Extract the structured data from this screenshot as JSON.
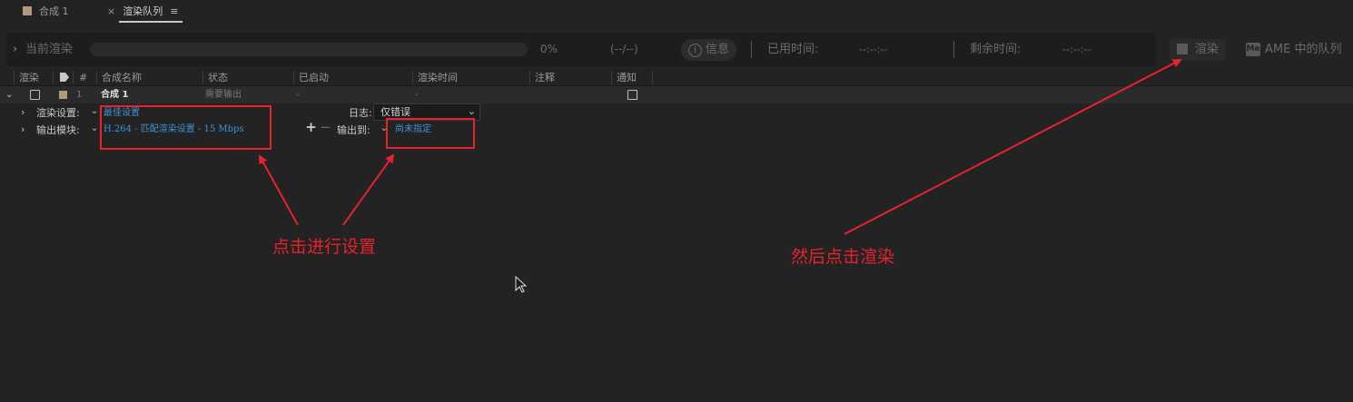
{
  "tabs": {
    "comp_tab_label": "合成 1",
    "render_queue_tab_label": "渲染队列",
    "close_glyph": "×",
    "menu_glyph": "≡"
  },
  "status_bar": {
    "current_render_label": "当前渲染",
    "percent": "0%",
    "ratio": "(--/--)",
    "info_label": "信息",
    "elapsed_label": "已用时间:",
    "elapsed_value": "--:--:--",
    "remaining_label": "剩余时间:",
    "remaining_value": "--:--:--",
    "progress_fraction": 0
  },
  "buttons": {
    "render_label": "渲染",
    "ame_label": "AME 中的队列",
    "ame_icon_text": "Me"
  },
  "columns": {
    "render": "渲染",
    "number": "#",
    "comp_name": "合成名称",
    "status": "状态",
    "started": "已启动",
    "render_time": "渲染时间",
    "comment": "注释",
    "notify": "通知"
  },
  "queue_item": {
    "number": "1",
    "comp_name": "合成 1",
    "status": "需要输出",
    "started": "-",
    "render_time": "-"
  },
  "render_settings": {
    "label": "渲染设置:",
    "value": "最佳设置"
  },
  "output_module": {
    "label": "输出模块:",
    "value": "H.264 - 匹配渲染设置 - 15 Mbps"
  },
  "log": {
    "label": "日志:",
    "value": "仅错误"
  },
  "output_to": {
    "label": "输出到:",
    "value": "尚未指定"
  },
  "annotations": {
    "settings_note": "点击进行设置",
    "render_note": "然后点击渲染"
  },
  "colors": {
    "annotation_red": "#e8222c",
    "link_blue": "#3f92d6",
    "background": "#232323"
  }
}
